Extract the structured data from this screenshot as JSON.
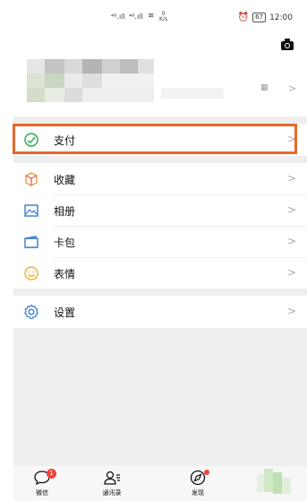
{
  "status_bar": {
    "signal1": "⁴⁶.ıll",
    "signal2": "⁴⁶.ıll",
    "wifi": "≋",
    "speed_value": "0",
    "speed_unit": "K/s",
    "alarm": "⏰",
    "battery": "67",
    "time": "12:00"
  },
  "profile": {
    "qr_icon": "qr-code-icon",
    "arrow": ">"
  },
  "menu": {
    "items": [
      {
        "label": "支付",
        "icon": "pay-icon",
        "color": "#27b04b",
        "arrow": ">"
      },
      {
        "label": "收藏",
        "icon": "favorites-icon",
        "color": "#f39c3b",
        "arrow": ">"
      },
      {
        "label": "相册",
        "icon": "album-icon",
        "color": "#3478d5",
        "arrow": ">"
      },
      {
        "label": "卡包",
        "icon": "card-wallet-icon",
        "color": "#3478d5",
        "arrow": ">"
      },
      {
        "label": "表情",
        "icon": "emoji-icon",
        "color": "#f2b233",
        "arrow": ">"
      },
      {
        "label": "设置",
        "icon": "settings-icon",
        "color": "#3478d5",
        "arrow": ">"
      }
    ]
  },
  "tabbar": {
    "tabs": [
      {
        "label": "微信",
        "badge": "1"
      },
      {
        "label": "通讯录"
      },
      {
        "label": "发现"
      }
    ]
  },
  "colors": {
    "highlight": "#e8672c",
    "badge": "#f0423c",
    "separator": "#eeeeee"
  }
}
